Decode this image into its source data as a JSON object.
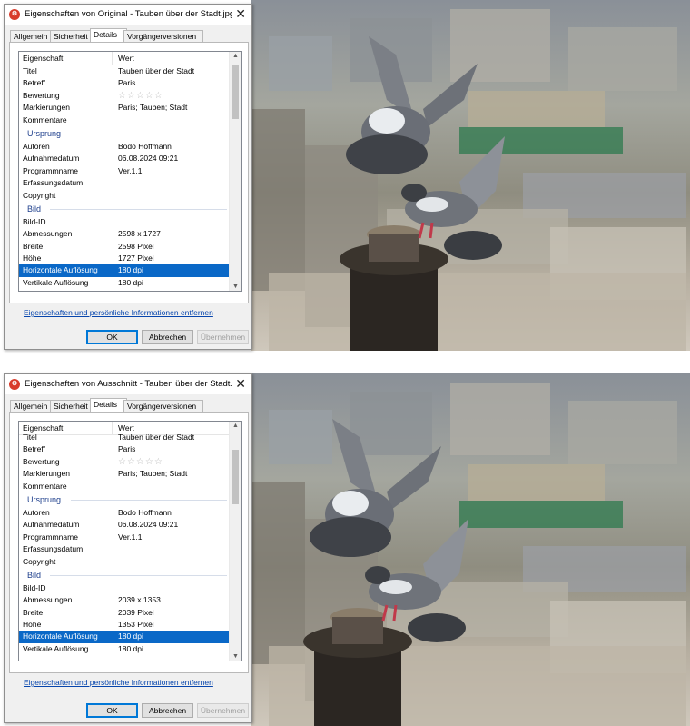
{
  "dialogs": [
    {
      "title": "Eigenschaften von Original - Tauben über der Stadt.jpg",
      "tabs": [
        "Allgemein",
        "Sicherheit",
        "Details",
        "Vorgängerversionen"
      ],
      "active_tab": "Details",
      "column_headers": [
        "Eigenschaft",
        "Wert"
      ],
      "groups": [
        {
          "name": "",
          "rows": [
            {
              "k": "Titel",
              "v": "Tauben über der Stadt"
            },
            {
              "k": "Betreff",
              "v": "Paris"
            },
            {
              "k": "Bewertung",
              "v": "☆☆☆☆☆"
            },
            {
              "k": "Markierungen",
              "v": "Paris; Tauben; Stadt"
            },
            {
              "k": "Kommentare",
              "v": ""
            }
          ]
        },
        {
          "name": "Ursprung",
          "rows": [
            {
              "k": "Autoren",
              "v": "Bodo Hoffmann"
            },
            {
              "k": "Aufnahmedatum",
              "v": "06.08.2024 09:21"
            },
            {
              "k": "Programmname",
              "v": "Ver.1.1"
            },
            {
              "k": "Erfassungsdatum",
              "v": ""
            },
            {
              "k": "Copyright",
              "v": ""
            }
          ]
        },
        {
          "name": "Bild",
          "rows": [
            {
              "k": "Bild-ID",
              "v": ""
            },
            {
              "k": "Abmessungen",
              "v": "2598 x 1727"
            },
            {
              "k": "Breite",
              "v": "2598 Pixel"
            },
            {
              "k": "Höhe",
              "v": "1727 Pixel"
            },
            {
              "k": "Horizontale Auflösung",
              "v": "180 dpi",
              "selected": true
            },
            {
              "k": "Vertikale Auflösung",
              "v": "180 dpi"
            }
          ]
        }
      ],
      "remove_link": "Eigenschaften und persönliche Informationen entfernen",
      "buttons": {
        "ok": "OK",
        "cancel": "Abbrechen",
        "apply": "Übernehmen"
      }
    },
    {
      "title": "Eigenschaften von Ausschnitt - Tauben über der Stadt.j...",
      "tabs": [
        "Allgemein",
        "Sicherheit",
        "Details",
        "Vorgängerversionen"
      ],
      "active_tab": "Details",
      "column_headers": [
        "Eigenschaft",
        "Wert"
      ],
      "groups": [
        {
          "name": "",
          "rows": [
            {
              "k": "Titel",
              "v": "Tauben über der Stadt"
            },
            {
              "k": "Betreff",
              "v": "Paris"
            },
            {
              "k": "Bewertung",
              "v": "☆☆☆☆☆"
            },
            {
              "k": "Markierungen",
              "v": "Paris; Tauben; Stadt"
            },
            {
              "k": "Kommentare",
              "v": ""
            }
          ]
        },
        {
          "name": "Ursprung",
          "rows": [
            {
              "k": "Autoren",
              "v": "Bodo Hoffmann"
            },
            {
              "k": "Aufnahmedatum",
              "v": "06.08.2024 09:21"
            },
            {
              "k": "Programmname",
              "v": "Ver.1.1"
            },
            {
              "k": "Erfassungsdatum",
              "v": ""
            },
            {
              "k": "Copyright",
              "v": ""
            }
          ]
        },
        {
          "name": "Bild",
          "rows": [
            {
              "k": "Bild-ID",
              "v": ""
            },
            {
              "k": "Abmessungen",
              "v": "2039 x 1353"
            },
            {
              "k": "Breite",
              "v": "2039 Pixel"
            },
            {
              "k": "Höhe",
              "v": "1353 Pixel"
            },
            {
              "k": "Horizontale Auflösung",
              "v": "180 dpi",
              "selected": true
            },
            {
              "k": "Vertikale Auflösung",
              "v": "180 dpi"
            }
          ]
        }
      ],
      "remove_link": "Eigenschaften und persönliche Informationen entfernen",
      "buttons": {
        "ok": "OK",
        "cancel": "Abbrechen",
        "apply": "Übernehmen"
      }
    }
  ],
  "selection_color": "#0a68c7",
  "group_header_color": "#1e3f8c",
  "link_color": "#0645ad",
  "icons": [
    "app-icon",
    "close-icon",
    "scroll-up-icon",
    "scroll-down-icon"
  ]
}
